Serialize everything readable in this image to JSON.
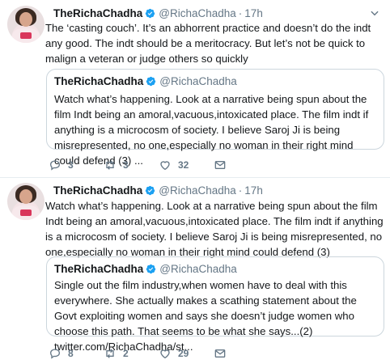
{
  "tweets": [
    {
      "author_name": "TheRichaChadha",
      "handle": "@RichaChadha",
      "separator": "·",
      "time": "17h",
      "text": "The ‘casting couch’. It’s an abhorrent practice and doesn’t do the indt any good. The indt should be a meritocracy. But let’s not be quick to malign a veteran or judge others so quickly",
      "quote": {
        "author_name": "TheRichaChadha",
        "handle": "@RichaChadha",
        "text": "Watch what’s happening. Look at a narrative being spun about the film Indt being an amoral,vacuous,intoxicated place. The film indt if anything is a microcosm of society. I believe Saroj Ji is being misrepresented, no one,especially no woman in their right mind could defend (3) ..."
      },
      "reply_count": "3",
      "retweet_count": "3",
      "like_count": "32"
    },
    {
      "author_name": "TheRichaChadha",
      "handle": "@RichaChadha",
      "separator": "·",
      "time": "17h",
      "text": "Watch what’s happening. Look at a narrative being spun about the film Indt being an amoral,vacuous,intoxicated place. The film indt if anything is a microcosm of society. I believe Saroj Ji is being misrepresented, no one,especially no woman in their right mind could defend (3)",
      "quote": {
        "author_name": "TheRichaChadha",
        "handle": "@RichaChadha",
        "text": "Single out the film industry,when women have to deal with this everywhere. She actually makes a scathing statement about the Govt exploiting women and says she doesn’t judge women who choose this path. That seems to be what she says...(2) twitter.com/RichaChadha/st..."
      },
      "reply_count": "8",
      "retweet_count": "2",
      "like_count": "29"
    }
  ],
  "icons": {
    "verified": "verified-badge-icon",
    "caret": "chevron-down-icon",
    "reply": "reply-icon",
    "retweet": "retweet-icon",
    "like": "heart-icon",
    "message": "envelope-icon"
  },
  "colors": {
    "text": "#14171a",
    "secondary": "#657786",
    "verified": "#1da1f2",
    "border": "#ccd6dd",
    "divider": "#e6ecf0"
  }
}
